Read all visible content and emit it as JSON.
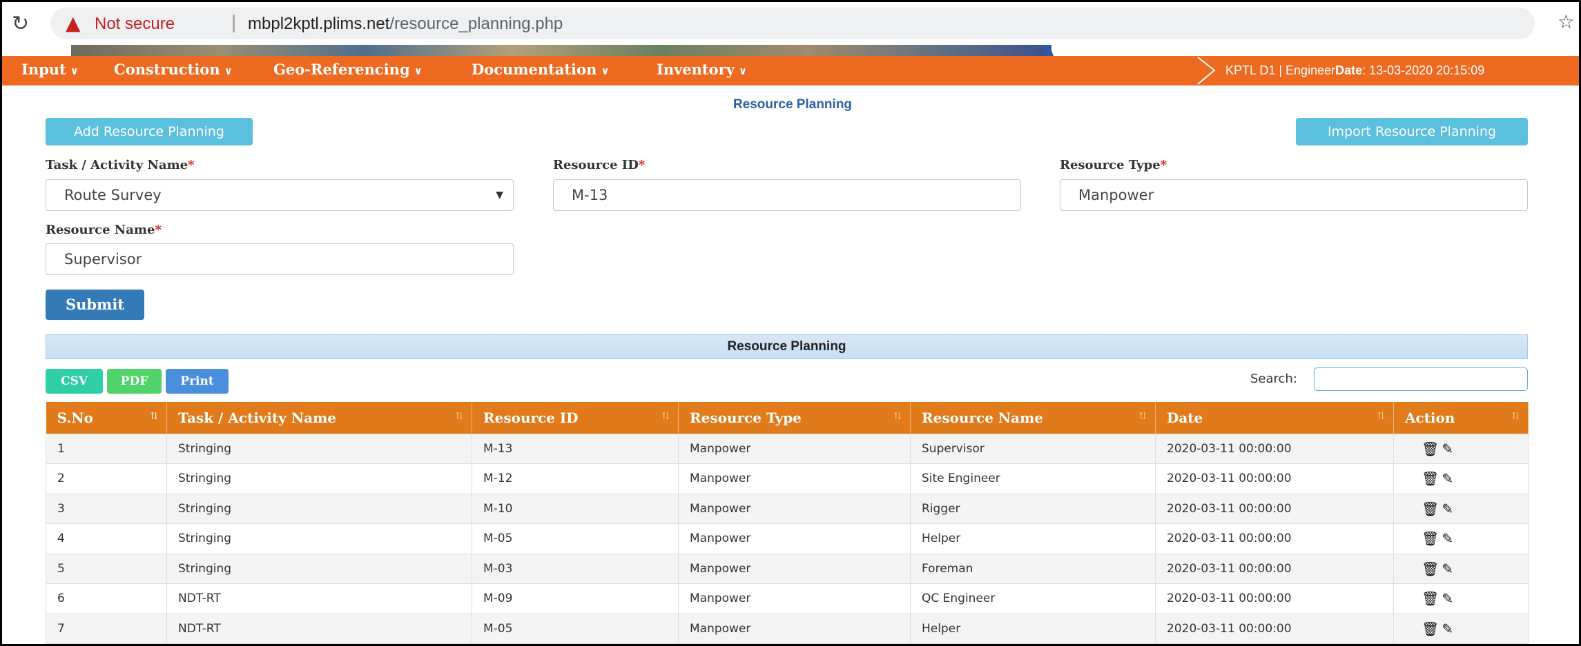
{
  "browser": {
    "warning": "Not secure",
    "separator": "|",
    "host": "mbpl2kptl.plims.net",
    "path": "/resource_planning.php"
  },
  "nav": {
    "items": [
      {
        "label": "Input"
      },
      {
        "label": "Construction"
      },
      {
        "label": "Geo-Referencing"
      },
      {
        "label": "Documentation"
      },
      {
        "label": "Inventory"
      }
    ],
    "status_user": "KPTL D1 | Engineer",
    "status_date_label": "Date",
    "status_date_value": ": 13-03-2020 20:15:09"
  },
  "page": {
    "title": "Resource Planning",
    "add_button": "Add Resource Planning",
    "import_button": "Import Resource Planning"
  },
  "form": {
    "task": {
      "label": "Task / Activity Name",
      "required": "*",
      "value": "Route Survey"
    },
    "resource_id": {
      "label": "Resource ID",
      "required": "*",
      "value": "M-13"
    },
    "resource_type": {
      "label": "Resource Type",
      "required": "*",
      "value": "Manpower"
    },
    "resource_name": {
      "label": "Resource Name",
      "required": "*",
      "value": "Supervisor"
    },
    "submit": "Submit"
  },
  "table_panel": {
    "title": "Resource Planning",
    "export_buttons": {
      "csv": "CSV",
      "pdf": "PDF",
      "print": "Print"
    },
    "search_label": "Search:",
    "columns": [
      "S.No",
      "Task / Activity Name",
      "Resource ID",
      "Resource Type",
      "Resource Name",
      "Date",
      "Action"
    ],
    "rows": [
      {
        "sno": "1",
        "task": "Stringing",
        "rid": "M-13",
        "rtype": "Manpower",
        "rname": "Supervisor",
        "date": "2020-03-11 00:00:00"
      },
      {
        "sno": "2",
        "task": "Stringing",
        "rid": "M-12",
        "rtype": "Manpower",
        "rname": "Site Engineer",
        "date": "2020-03-11 00:00:00"
      },
      {
        "sno": "3",
        "task": "Stringing",
        "rid": "M-10",
        "rtype": "Manpower",
        "rname": "Rigger",
        "date": "2020-03-11 00:00:00"
      },
      {
        "sno": "4",
        "task": "Stringing",
        "rid": "M-05",
        "rtype": "Manpower",
        "rname": "Helper",
        "date": "2020-03-11 00:00:00"
      },
      {
        "sno": "5",
        "task": "Stringing",
        "rid": "M-03",
        "rtype": "Manpower",
        "rname": "Foreman",
        "date": "2020-03-11 00:00:00"
      },
      {
        "sno": "6",
        "task": "NDT-RT",
        "rid": "M-09",
        "rtype": "Manpower",
        "rname": "QC Engineer",
        "date": "2020-03-11 00:00:00"
      },
      {
        "sno": "7",
        "task": "NDT-RT",
        "rid": "M-05",
        "rtype": "Manpower",
        "rname": "Helper",
        "date": "2020-03-11 00:00:00"
      }
    ]
  },
  "colors": {
    "nav_bg": "#ef6a21",
    "table_header_bg": "#e07a1a",
    "info_button": "#5bc0de",
    "submit_button": "#337ab7",
    "csv_button": "#2ecfa7",
    "pdf_button": "#4fd36a",
    "print_button": "#4a8fdc"
  },
  "icons": {
    "reload": "reload-icon",
    "warning": "warning-icon",
    "bookmark": "star-icon",
    "delete": "trash-icon",
    "edit": "pencil-icon"
  }
}
